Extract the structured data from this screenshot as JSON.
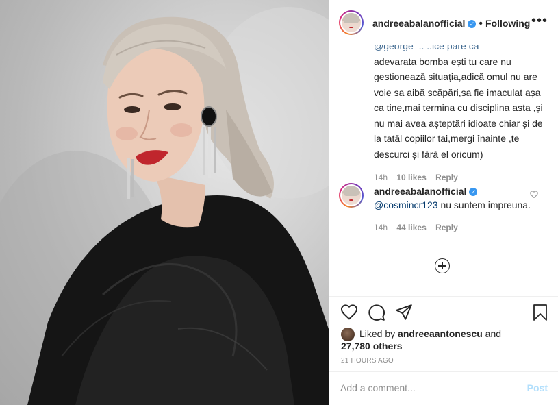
{
  "post": {
    "author": "andreeabalanofficial",
    "follow_separator": "•",
    "follow_status": "Following",
    "more_glyph": "•••"
  },
  "comments": [
    {
      "top_partial": "@george_.. ..ice pare ca",
      "text": "adevarata bomba ești tu care nu gestionează situația,adică omul nu are voie sa aibă scăpări,sa fie imaculat așa ca tine,mai termina cu disciplina asta ,și nu mai avea așteptări idioate chiar și de la tatăl copiilor tai,mergi înainte ,te descurci și fără el oricum)",
      "time": "14h",
      "likes": "10 likes",
      "reply": "Reply"
    },
    {
      "author": "andreeabalanofficial",
      "mention": "@cosmincr123",
      "text": " nu suntem impreuna.",
      "time": "14h",
      "likes": "44 likes",
      "reply": "Reply"
    }
  ],
  "liked_by": {
    "prefix": "Liked by ",
    "user": "andreeaantonescu",
    "and": " and",
    "others": "27,780 others"
  },
  "time_ago": "21 HOURS AGO",
  "add_comment": {
    "placeholder": "Add a comment...",
    "post_label": "Post"
  },
  "colors": {
    "link": "#00376b",
    "verified": "#3897f0",
    "muted": "#8e8e8e",
    "post_disabled": "#b2dffc",
    "lips": "#c0262d"
  },
  "icons": [
    "heart-icon",
    "comment-icon",
    "share-icon",
    "bookmark-icon",
    "verified-icon",
    "more-icon",
    "plus-circle-icon"
  ]
}
